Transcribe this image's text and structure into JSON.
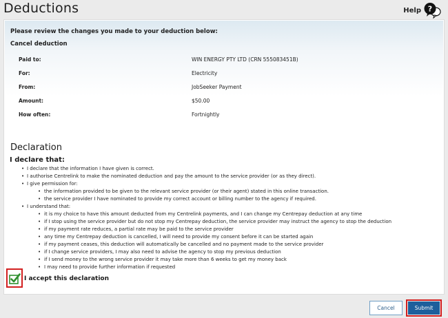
{
  "header": {
    "title": "Deductions",
    "help_label": "Help"
  },
  "review": {
    "heading": "Please review the changes you made to your deduction below:",
    "subheading": "Cancel deduction",
    "rows": [
      {
        "label": "Paid to:",
        "value": "WIN ENERGY PTY LTD (CRN 555083451B)"
      },
      {
        "label": "For:",
        "value": "Electricity"
      },
      {
        "label": "From:",
        "value": "JobSeeker Payment"
      },
      {
        "label": "Amount:",
        "value": "$50.00"
      },
      {
        "label": "How often:",
        "value": "Fortnightly"
      }
    ]
  },
  "declaration": {
    "title": "Declaration",
    "subtitle": "I declare that:",
    "items": [
      "I declare that the information I have given is correct.",
      "I authorise Centrelink to make the nominated deduction and pay the amount to the service provider (or as they direct).",
      "I give permission for:",
      "I understand that:"
    ],
    "permission_items": [
      "the information provided to be given to the relevant service provider (or their agent) stated in this online transaction.",
      "the service provider I have nominated to provide my correct account or billing number to the agency if required."
    ],
    "understand_items": [
      "it is my choice to have this amount deducted from my Centrelink payments, and I can change my Centrepay deduction at any time",
      "if I stop using the service provider but do not stop my Centrepay deduction, the service provider may instruct the agency to stop the deduction",
      "if my payment rate reduces, a partial rate may be paid to the service provider",
      "any time my Centrepay deduction is cancelled, I will need to provide my consent before it can be started again",
      "if my payment ceases, this deduction will automatically be cancelled and no payment made to the service provider",
      "if I change service providers, I may also need to advise the agency to stop my previous deduction",
      "if I send money to the wrong service provider it may take more than 6 weeks to get my money back",
      "I may need to provide further information if requested"
    ],
    "accept_label": "I accept this declaration",
    "accepted": true
  },
  "actions": {
    "cancel_label": "Cancel",
    "submit_label": "Submit"
  },
  "colors": {
    "highlight": "#d21f1f",
    "check": "#2f8f2f",
    "primary": "#1d5f9c"
  },
  "icons": {
    "help": "help-question-bubble-icon",
    "accept": "checkbox-checked-icon"
  }
}
